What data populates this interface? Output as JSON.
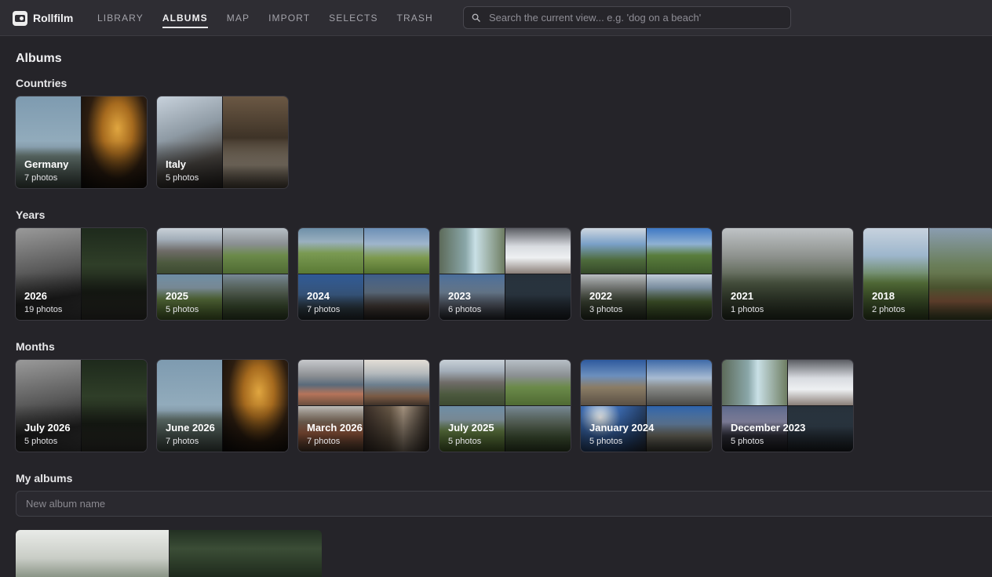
{
  "app": {
    "name": "Rollfilm",
    "logo_icon": "camera-icon"
  },
  "nav": {
    "items": [
      {
        "label": "LIBRARY",
        "active": false
      },
      {
        "label": "ALBUMS",
        "active": true
      },
      {
        "label": "MAP",
        "active": false
      },
      {
        "label": "IMPORT",
        "active": false
      },
      {
        "label": "SELECTS",
        "active": false
      },
      {
        "label": "TRASH",
        "active": false
      }
    ]
  },
  "search": {
    "placeholder": "Search the current view... e.g. 'dog on a beach'",
    "value": "",
    "icon": "search-icon"
  },
  "page": {
    "title": "Albums"
  },
  "sections": {
    "countries": {
      "title": "Countries",
      "albums": [
        {
          "title": "Germany",
          "count": "7 photos",
          "tiles": [
            "p-lake",
            "p-window"
          ]
        },
        {
          "title": "Italy",
          "count": "5 photos",
          "tiles": [
            "p-italy-sky",
            "p-alley"
          ]
        }
      ]
    },
    "years": {
      "title": "Years",
      "albums": [
        {
          "title": "2026",
          "count": "19 photos",
          "tiles": [
            "p-bw",
            "p-park"
          ]
        },
        {
          "title": "2025",
          "count": "5 photos",
          "tiles": [
            "p-mtn",
            "p-alp",
            "p-meadow",
            "p-valley"
          ]
        },
        {
          "title": "2024",
          "count": "7 photos",
          "tiles": [
            "p-meadow",
            "p-tree",
            "p-blue",
            "p-dusk"
          ]
        },
        {
          "title": "2023",
          "count": "6 photos",
          "tiles": [
            "p-river",
            "p-snow",
            "p-dawn",
            "p-dark"
          ]
        },
        {
          "title": "2022",
          "count": "3 photos",
          "tiles": [
            "p-cloud",
            "p-green",
            "p-forest",
            "p-hill"
          ]
        },
        {
          "title": "2021",
          "count": "1 photos",
          "tiles": [
            "p-forest"
          ]
        },
        {
          "title": "2018",
          "count": "2 photos",
          "tiles": [
            "p-hill",
            "p-village"
          ]
        }
      ]
    },
    "months": {
      "title": "Months",
      "albums": [
        {
          "title": "July 2026",
          "count": "5 photos",
          "tiles": [
            "p-bw",
            "p-park"
          ]
        },
        {
          "title": "June 2026",
          "count": "7 photos",
          "tiles": [
            "p-lake",
            "p-window"
          ]
        },
        {
          "title": "March 2026",
          "count": "7 photos",
          "tiles": [
            "p-coast",
            "p-sea",
            "p-town",
            "p-street"
          ]
        },
        {
          "title": "July 2025",
          "count": "5 photos",
          "tiles": [
            "p-mtn",
            "p-alp",
            "p-meadow",
            "p-valley"
          ]
        },
        {
          "title": "January 2024",
          "count": "5 photos",
          "tiles": [
            "p-stony",
            "p-ridge",
            "p-sun",
            "p-mist"
          ]
        },
        {
          "title": "December 2023",
          "count": "5 photos",
          "tiles": [
            "p-river",
            "p-snow",
            "p-blossom",
            "p-dark"
          ]
        }
      ]
    },
    "my_albums": {
      "title": "My albums",
      "new_album_placeholder": "New album name",
      "new_album_value": "",
      "preview_tiles": [
        "p-white",
        "p-trees"
      ]
    }
  },
  "colors": {
    "background": "#252429",
    "topbar": "#2e2d33",
    "text": "#e8e8ea",
    "muted_text": "#a3a3aa"
  }
}
